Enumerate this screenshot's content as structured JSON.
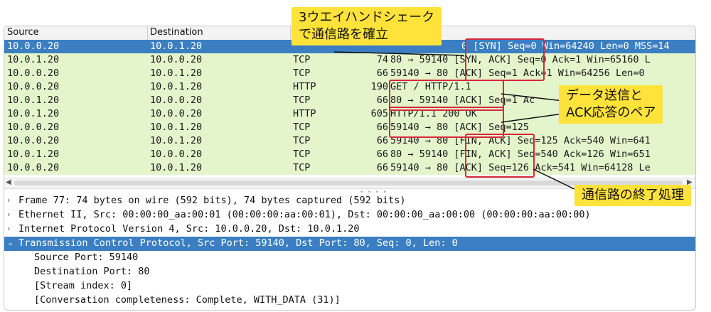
{
  "columns": {
    "source": "Source",
    "destination": "Destination"
  },
  "packets": [
    {
      "src": "10.0.0.20",
      "dst": "10.0.1.20",
      "proto": "",
      "len": "",
      "info": "0 [SYN] Seq=0 Win=64240 Len=0 MSS=14",
      "selected": true
    },
    {
      "src": "10.0.1.20",
      "dst": "10.0.0.20",
      "proto": "TCP",
      "len": "74",
      "info": "80 → 59140 [SYN, ACK] Seq=0 Ack=1 Win=65160 L"
    },
    {
      "src": "10.0.0.20",
      "dst": "10.0.1.20",
      "proto": "TCP",
      "len": "66",
      "info": "59140 → 80 [ACK] Seq=1 Ack=1 Win=64256 Len=0"
    },
    {
      "src": "10.0.0.20",
      "dst": "10.0.1.20",
      "proto": "HTTP",
      "len": "190",
      "info": "GET / HTTP/1.1"
    },
    {
      "src": "10.0.1.20",
      "dst": "10.0.0.20",
      "proto": "TCP",
      "len": "66",
      "info": "80 → 59140 [ACK] Seq=1 Ac"
    },
    {
      "src": "10.0.1.20",
      "dst": "10.0.0.20",
      "proto": "HTTP",
      "len": "605",
      "info": "HTTP/1.1 200 OK"
    },
    {
      "src": "10.0.0.20",
      "dst": "10.0.1.20",
      "proto": "TCP",
      "len": "66",
      "info": "59140 → 80 [ACK] Seq=125"
    },
    {
      "src": "10.0.0.20",
      "dst": "10.0.1.20",
      "proto": "TCP",
      "len": "66",
      "info": "59140 → 80 [FIN, ACK] Seq=125 Ack=540 Win=641"
    },
    {
      "src": "10.0.1.20",
      "dst": "10.0.0.20",
      "proto": "TCP",
      "len": "66",
      "info": "80 → 59140 [FIN, ACK] Seq=540 Ack=126 Win=651"
    },
    {
      "src": "10.0.0.20",
      "dst": "10.0.1.20",
      "proto": "TCP",
      "len": "66",
      "info": "59140 → 80 [ACK] Seq=126 Ack=541 Win=64128 Le"
    }
  ],
  "details": [
    {
      "toggle": "›",
      "text": "Frame 77: 74 bytes on wire (592 bits), 74 bytes captured (592 bits)"
    },
    {
      "toggle": "›",
      "text": "Ethernet II, Src: 00:00:00_aa:00:01 (00:00:00:aa:00:01), Dst: 00:00:00_aa:00:00 (00:00:00:aa:00:00)"
    },
    {
      "toggle": "›",
      "text": "Internet Protocol Version 4, Src: 10.0.0.20, Dst: 10.0.1.20"
    },
    {
      "toggle": "⌄",
      "text": "Transmission Control Protocol, Src Port: 59140, Dst Port: 80, Seq: 0, Len: 0",
      "selected": true
    },
    {
      "text": "Source Port: 59140",
      "child": true
    },
    {
      "text": "Destination Port: 80",
      "child": true
    },
    {
      "text": "[Stream index: 0]",
      "child": true
    },
    {
      "text": "[Conversation completeness: Complete, WITH_DATA (31)]",
      "child": true
    }
  ],
  "callouts": {
    "handshake": [
      "3ウエイハンドシェーク",
      "で通信路を確立"
    ],
    "data_ack": [
      "データ送信と",
      "ACK応答のペア"
    ],
    "termination": [
      "通信路の終了処理"
    ]
  },
  "colors": {
    "selected_row": "#3b7fc2",
    "tcp_row": "#e4f5cc",
    "callout_bg": "#ffe23a",
    "box": "#d8283a"
  }
}
